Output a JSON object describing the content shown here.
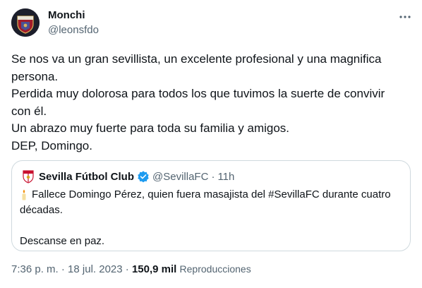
{
  "author": {
    "name": "Monchi",
    "handle": "@leonsfdo",
    "avatar_icon": "sevilla-crest-avatar"
  },
  "tweet": {
    "lines": [
      "Se nos va un gran sevillista, un excelente profesional y una magnifica",
      "persona.",
      "Perdida muy dolorosa para todos los que tuvimos la suerte de convivir",
      "con él.",
      "Un abrazo muy fuerte para toda su familia y amigos.",
      "DEP, Domingo."
    ]
  },
  "quote": {
    "name": "Sevilla Fútbol Club",
    "handle": "@SevillaFC",
    "separator": "·",
    "time": "11h",
    "lines": [
      "Fallece Domingo Pérez, quien fuera masajista del #SevillaFC durante cuatro",
      "décadas.",
      "Descanse en paz."
    ],
    "logo_icon": "sevilla-fc-crest",
    "verified_icon": "verified-badge-icon",
    "candle_icon": "candle-icon"
  },
  "meta": {
    "time": "7:36 p. m.",
    "separator": "·",
    "date": "18 jul. 2023",
    "views_count": "150,9 mil",
    "views_label": "Reproducciones"
  },
  "colors": {
    "text": "#0f1419",
    "secondary": "#536471",
    "border": "#cfd9de",
    "verified": "#1d9bf0",
    "avatar_bg": "#1c1e2b",
    "crest_red": "#c8102e"
  }
}
